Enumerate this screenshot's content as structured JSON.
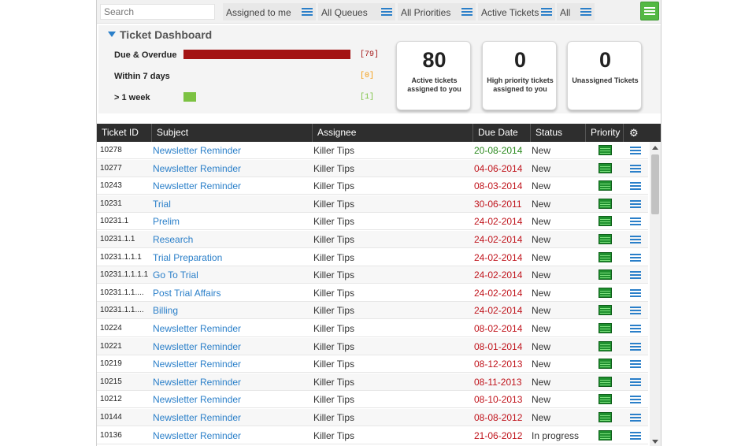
{
  "filters": {
    "search_placeholder": "Search",
    "assigned": "Assigned to me",
    "queues": "All Queues",
    "priorities": "All Priorities",
    "status": "Active Tickets",
    "all": "All"
  },
  "dashboard": {
    "title": "Ticket Dashboard",
    "metrics": [
      {
        "label": "Due & Overdue",
        "count": "[79]",
        "value": 79,
        "color": "#a31414"
      },
      {
        "label": "Within 7 days",
        "count": "[0]",
        "value": 0,
        "color": "#f39c12"
      },
      {
        "label": "> 1 week",
        "count": "[1]",
        "value": 1,
        "color": "#7cc242"
      }
    ],
    "cards": [
      {
        "number": "80",
        "caption": "Active tickets assigned to you"
      },
      {
        "number": "0",
        "caption": "High priority tickets assigned to you"
      },
      {
        "number": "0",
        "caption": "Unassigned Tickets"
      }
    ]
  },
  "table": {
    "headers": {
      "id": "Ticket ID",
      "subject": "Subject",
      "assignee": "Assignee",
      "due": "Due Date",
      "status": "Status",
      "priority": "Priority"
    },
    "overdue_color": "#c0141c",
    "ontime_color": "#2b8a1e",
    "rows": [
      {
        "id": "10278",
        "subject": "Newsletter Reminder",
        "assignee": "Killer Tips",
        "due": "20-08-2014",
        "status": "New",
        "overdue": false
      },
      {
        "id": "10277",
        "subject": "Newsletter Reminder",
        "assignee": "Killer Tips",
        "due": "04-06-2014",
        "status": "New",
        "overdue": true
      },
      {
        "id": "10243",
        "subject": "Newsletter Reminder",
        "assignee": "Killer Tips",
        "due": "08-03-2014",
        "status": "New",
        "overdue": true
      },
      {
        "id": "10231",
        "subject": "Trial",
        "assignee": "Killer Tips",
        "due": "30-06-2011",
        "status": "New",
        "overdue": true
      },
      {
        "id": "10231.1",
        "subject": "Prelim",
        "assignee": "Killer Tips",
        "due": "24-02-2014",
        "status": "New",
        "overdue": true
      },
      {
        "id": "10231.1.1",
        "subject": "Research",
        "assignee": "Killer Tips",
        "due": "24-02-2014",
        "status": "New",
        "overdue": true
      },
      {
        "id": "10231.1.1.1",
        "subject": "Trial Preparation",
        "assignee": "Killer Tips",
        "due": "24-02-2014",
        "status": "New",
        "overdue": true
      },
      {
        "id": "10231.1.1.1.1",
        "subject": "Go To Trial",
        "assignee": "Killer Tips",
        "due": "24-02-2014",
        "status": "New",
        "overdue": true
      },
      {
        "id": "10231.1.1....",
        "subject": "Post Trial Affairs",
        "assignee": "Killer Tips",
        "due": "24-02-2014",
        "status": "New",
        "overdue": true
      },
      {
        "id": "10231.1.1....",
        "subject": "Billing",
        "assignee": "Killer Tips",
        "due": "24-02-2014",
        "status": "New",
        "overdue": true
      },
      {
        "id": "10224",
        "subject": "Newsletter Reminder",
        "assignee": "Killer Tips",
        "due": "08-02-2014",
        "status": "New",
        "overdue": true
      },
      {
        "id": "10221",
        "subject": "Newsletter Reminder",
        "assignee": "Killer Tips",
        "due": "08-01-2014",
        "status": "New",
        "overdue": true
      },
      {
        "id": "10219",
        "subject": "Newsletter Reminder",
        "assignee": "Killer Tips",
        "due": "08-12-2013",
        "status": "New",
        "overdue": true
      },
      {
        "id": "10215",
        "subject": "Newsletter Reminder",
        "assignee": "Killer Tips",
        "due": "08-11-2013",
        "status": "New",
        "overdue": true
      },
      {
        "id": "10212",
        "subject": "Newsletter Reminder",
        "assignee": "Killer Tips",
        "due": "08-10-2013",
        "status": "New",
        "overdue": true
      },
      {
        "id": "10144",
        "subject": "Newsletter Reminder",
        "assignee": "Killer Tips",
        "due": "08-08-2012",
        "status": "New",
        "overdue": true
      },
      {
        "id": "10136",
        "subject": "Newsletter Reminder",
        "assignee": "Killer Tips",
        "due": "21-06-2012",
        "status": "In progress",
        "overdue": true
      }
    ]
  }
}
